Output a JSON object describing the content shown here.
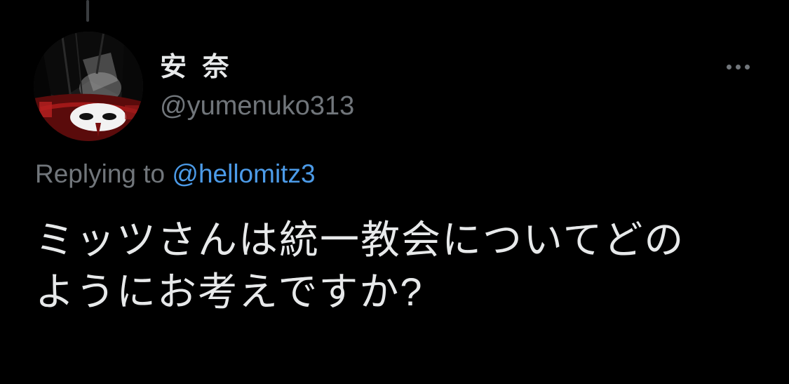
{
  "tweet": {
    "author": {
      "display_name": "安 奈",
      "handle": "@yumenuko313",
      "avatar_icon": "profile-avatar-image"
    },
    "more_icon": "more-horizontal-icon",
    "reply_context": {
      "prefix": "Replying to ",
      "mention": "@hellomitz3"
    },
    "text_lines": [
      "ミッツさんは統一教会についてどの",
      "ようにお考えですか?"
    ]
  },
  "colors": {
    "background": "#000000",
    "primary_text": "#e7e9ea",
    "secondary_text": "#71767b",
    "link": "#4c9be8",
    "thread_line": "#3a3d40"
  }
}
